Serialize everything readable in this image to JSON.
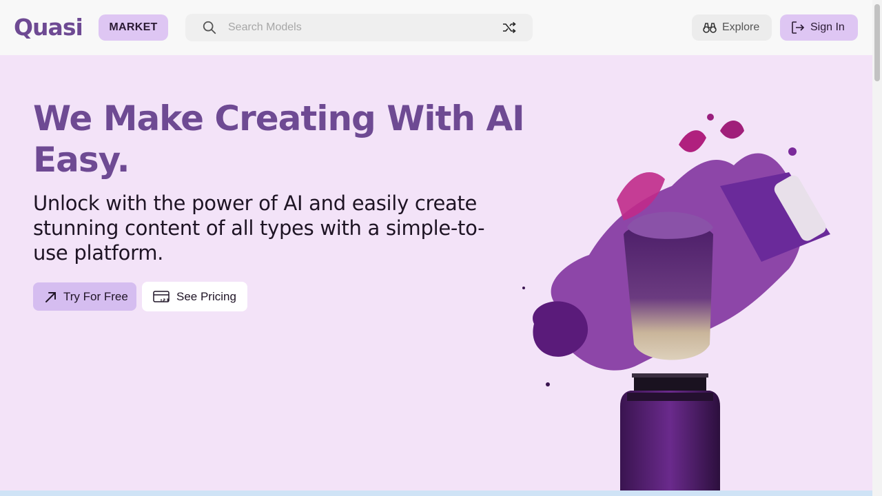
{
  "header": {
    "logo": "Quasi",
    "badge": "MARKET",
    "search": {
      "placeholder": "Search Models",
      "value": ""
    },
    "explore_label": "Explore",
    "signin_label": "Sign In"
  },
  "hero": {
    "title": "We Make Creating With AI Easy.",
    "subtitle": "Unlock with the power of AI and easily create stunning content of all types with a simple-to-use platform.",
    "primary_cta": "Try For Free",
    "secondary_cta": "See Pricing"
  },
  "icons": {
    "search": "search-icon",
    "shuffle": "shuffle-icon",
    "explore": "binoculars-icon",
    "signin": "sign-in-icon",
    "try": "arrow-up-right-icon",
    "pricing": "price-tag-icon"
  },
  "colors": {
    "brand": "#6e4a93",
    "accent_light": "#dec6f3",
    "hero_bg": "#f3e3f8",
    "header_bg": "#f8f8f8"
  }
}
